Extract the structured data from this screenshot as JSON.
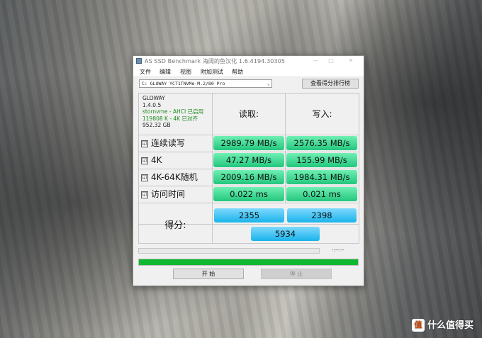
{
  "window": {
    "title": "AS SSD Benchmark 海阔的鱼汉化 1.6.4194.30305",
    "controls": {
      "minimize": "—",
      "maximize": "□",
      "close": "✕"
    }
  },
  "menu": [
    "文件",
    "编辑",
    "视图",
    "附加测试",
    "帮助"
  ],
  "drive": {
    "selected": "C: GLOWAY YCT1TNVMe-M.2/80 Pro",
    "rank_button": "查看得分排行榜"
  },
  "device_info": {
    "brand": "GLOWAY",
    "firmware": "1.4.0.5",
    "driver": "stornvme - AHCI 已启用",
    "alignment": "119808 K - 4K 已对齐",
    "capacity": "952.32 GB"
  },
  "columns": {
    "read": "读取:",
    "write": "写入:"
  },
  "tests": [
    {
      "label": "连续读写",
      "checked": "☑",
      "read": "2989.79 MB/s",
      "write": "2576.35 MB/s"
    },
    {
      "label": "4K",
      "checked": "☑",
      "read": "47.27 MB/s",
      "write": "155.99 MB/s"
    },
    {
      "label": "4K-64K随机",
      "checked": "☑",
      "read": "2009.16 MB/s",
      "write": "1984.31 MB/s"
    },
    {
      "label": "访问时间",
      "checked": "☑",
      "read": "0.022 ms",
      "write": "0.021 ms"
    }
  ],
  "score": {
    "label": "得分:",
    "read": "2355",
    "write": "2398",
    "total": "5934"
  },
  "timer": "-:--:--",
  "progress": {
    "overall_fraction": 1.0
  },
  "buttons": {
    "start": "开 始",
    "stop": "停 止"
  },
  "watermark": {
    "badge": "值",
    "text": "什么值得买"
  },
  "colors": {
    "result_green": "#2ecc88",
    "score_blue": "#19b3ea",
    "progress_green": "#10b830"
  }
}
